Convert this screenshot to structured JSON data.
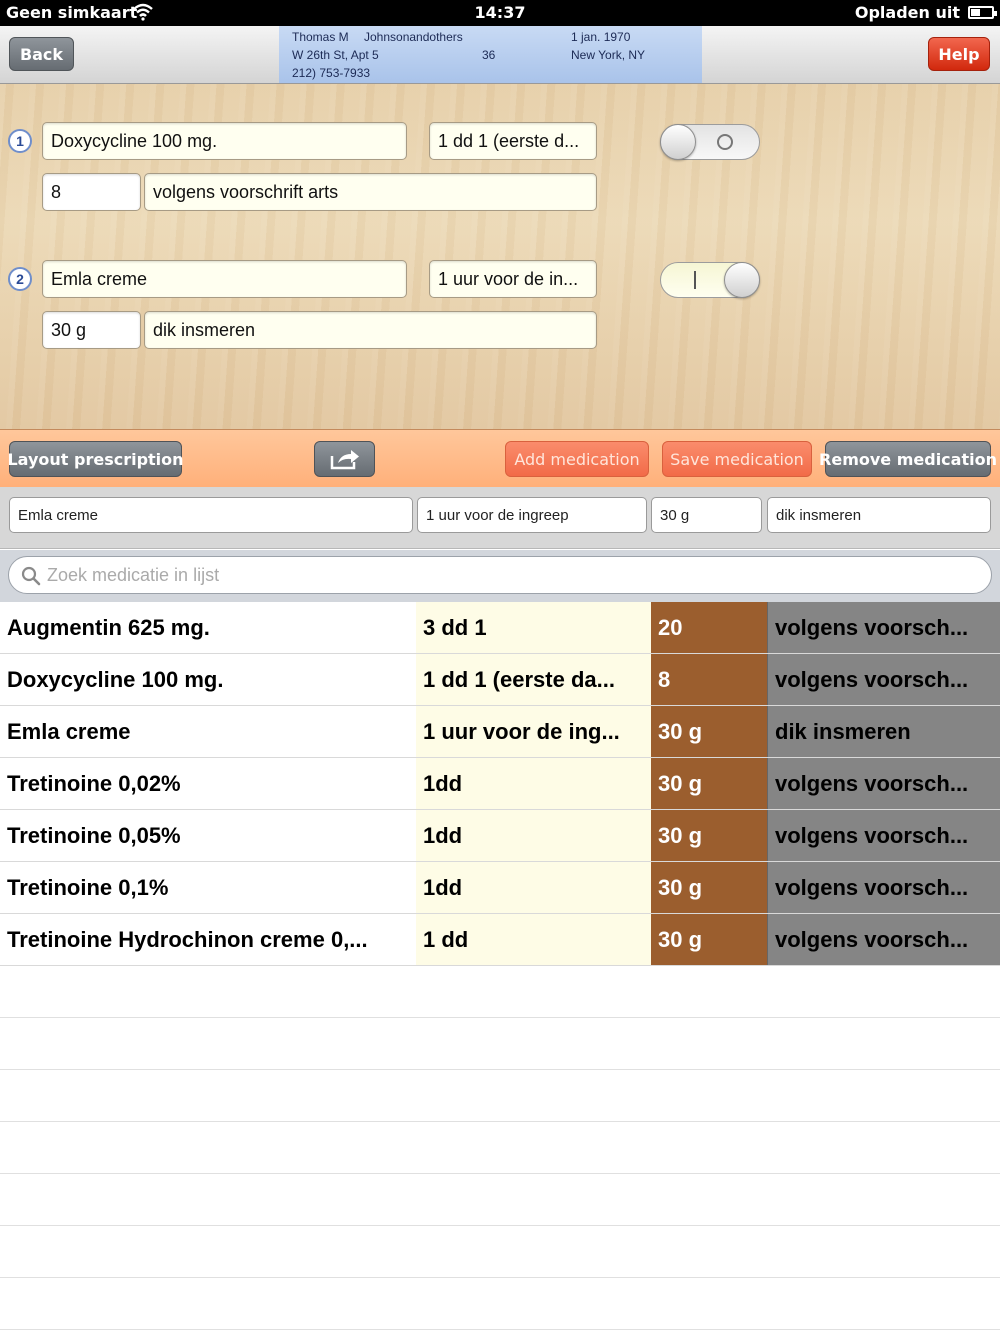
{
  "status_bar": {
    "carrier": "Geen simkaart",
    "time": "14:37",
    "charging": "Opladen uit",
    "wifi_icon": "wifi-icon",
    "battery_icon": "battery-icon"
  },
  "nav": {
    "back_label": "Back",
    "help_label": "Help",
    "patient": {
      "first_name": "Thomas M",
      "last_name": "Johnsonandothers",
      "birth_date": "1 jan. 1970",
      "street": "W 26th St, Apt 5",
      "age": "36",
      "city": "New York, NY",
      "phone": "212) 753-7933"
    }
  },
  "prescription": [
    {
      "number": "1",
      "name": "Doxycycline 100 mg.",
      "dosage": "1 dd 1 (eerste d...",
      "quantity": "8",
      "instructions": "volgens voorschrift arts",
      "toggle": "off"
    },
    {
      "number": "2",
      "name": "Emla creme",
      "dosage": "1 uur voor de in...",
      "quantity": "30 g",
      "instructions": "dik insmeren",
      "toggle": "on"
    }
  ],
  "actions": {
    "layout_label": "Layout prescription",
    "share_icon": "share-icon",
    "add_label": "Add medication",
    "save_label": "Save medication",
    "remove_label": "Remove medication"
  },
  "edit": {
    "name": "Emla creme",
    "dosage": "1 uur voor de ingreep",
    "quantity": "30 g",
    "instructions": "dik insmeren"
  },
  "search": {
    "placeholder": "Zoek medicatie in lijst",
    "icon": "search-icon"
  },
  "medications": [
    {
      "name": "Augmentin 625 mg.",
      "dosage": "3 dd 1",
      "quantity": "20",
      "instructions": "volgens voorsch..."
    },
    {
      "name": "Doxycycline 100 mg.",
      "dosage": "1 dd 1 (eerste da...",
      "quantity": "8",
      "instructions": "volgens voorsch..."
    },
    {
      "name": "Emla creme",
      "dosage": "1 uur voor de ing...",
      "quantity": "30 g",
      "instructions": "dik insmeren"
    },
    {
      "name": "Tretinoine 0,02%",
      "dosage": "1dd",
      "quantity": "30 g",
      "instructions": "volgens voorsch..."
    },
    {
      "name": "Tretinoine 0,05%",
      "dosage": "1dd",
      "quantity": "30 g",
      "instructions": "volgens voorsch..."
    },
    {
      "name": "Tretinoine 0,1%",
      "dosage": "1dd",
      "quantity": "30 g",
      "instructions": "volgens voorsch..."
    },
    {
      "name": "Tretinoine Hydrochinon creme 0,...",
      "dosage": "1 dd",
      "quantity": "30 g",
      "instructions": "volgens voorsch..."
    }
  ],
  "colors": {
    "brand_blue": "#a9c3ea",
    "help_red": "#d1280d",
    "action_orange": "#ffb07a",
    "quantity_brown": "#9b5e2e",
    "instructions_gray": "#858585"
  }
}
